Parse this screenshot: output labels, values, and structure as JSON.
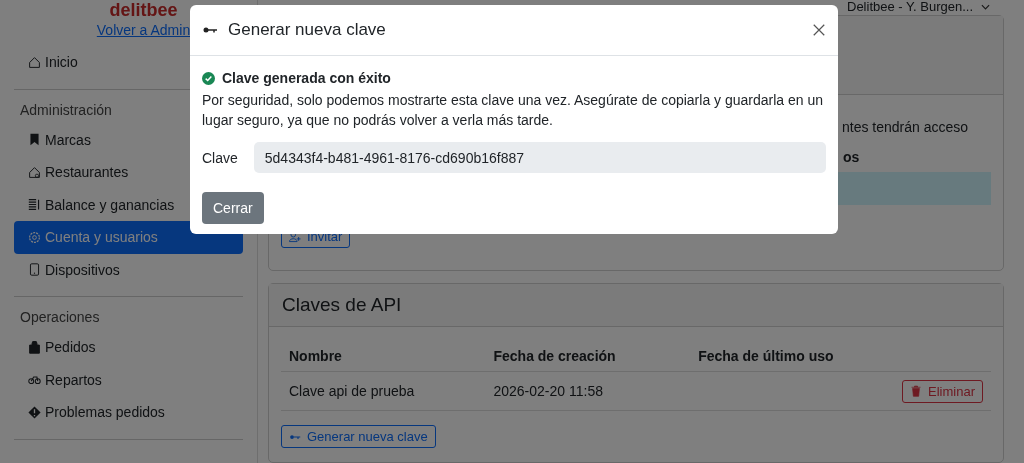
{
  "sidebar": {
    "logo": "delitbee",
    "back_link": "Volver a Admin",
    "sections": [
      {
        "items": [
          {
            "label": "Inicio",
            "kind": "home",
            "selected": false
          }
        ]
      },
      {
        "title": "Administración",
        "items": [
          {
            "label": "Marcas",
            "kind": "bookmark",
            "selected": false
          },
          {
            "label": "Restaurantes",
            "kind": "store",
            "selected": false
          },
          {
            "label": "Balance y ganancias",
            "kind": "list",
            "selected": false
          },
          {
            "label": "Cuenta y usuarios",
            "kind": "gear",
            "selected": true
          },
          {
            "label": "Dispositivos",
            "kind": "tablet",
            "selected": false
          }
        ]
      },
      {
        "title": "Operaciones",
        "items": [
          {
            "label": "Pedidos",
            "kind": "bag",
            "selected": false
          },
          {
            "label": "Repartos",
            "kind": "bike",
            "selected": false
          },
          {
            "label": "Problemas pedidos",
            "kind": "warning",
            "selected": false
          }
        ]
      }
    ]
  },
  "header": {
    "account": "Delitbee - Y. Burgen..."
  },
  "users_card": {
    "text_fragment": "ntes tendrán acceso",
    "column_fragment": "os",
    "invite_button": "Invitar"
  },
  "api_keys_card": {
    "title": "Claves de API",
    "columns": [
      "Nombre",
      "Fecha de creación",
      "Fecha de último uso"
    ],
    "rows": [
      {
        "name": "Clave api de prueba",
        "created": "2026-02-20 11:58",
        "delete_button": "Eliminar"
      }
    ],
    "generate_button": "Generar nueva clave"
  },
  "modal": {
    "title": "Generar nueva clave",
    "success": "Clave generada con éxito",
    "message": "Por seguridad, solo podemos mostrarte esta clave una vez. Asegúrate de copiarla y guardarla en un lugar seguro, ya que no podrás volver a verla más tarde.",
    "field_label": "Clave",
    "key_value": "5d4343f4-b481-4961-8176-cd690b16f887",
    "close_button": "Cerrar"
  }
}
